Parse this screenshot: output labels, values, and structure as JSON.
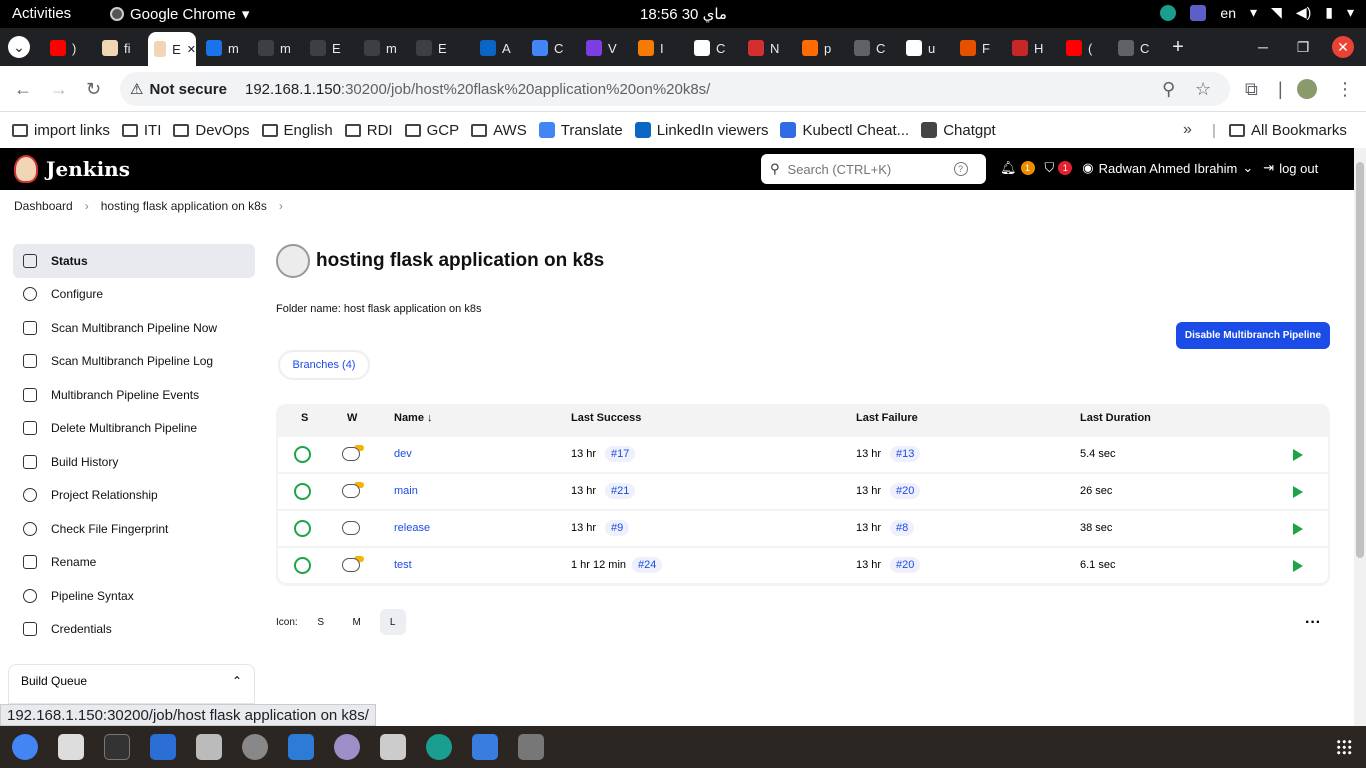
{
  "system": {
    "activities": "Activities",
    "app_name": "Google Chrome",
    "clock": "ماي 30  18:56",
    "lang": "en"
  },
  "tabs": [
    {
      "label": ")",
      "color": "#ff0000"
    },
    {
      "label": "fi",
      "color": "#f0d6b5"
    },
    {
      "label": "E",
      "color": "#f0d6b5",
      "active": true
    },
    {
      "label": "m",
      "color": "#1a73e8"
    },
    {
      "label": "m",
      "color": "#3c4043"
    },
    {
      "label": "E",
      "color": "#3c4043"
    },
    {
      "label": "m",
      "color": "#3c4043"
    },
    {
      "label": "E",
      "color": "#3c4043"
    },
    {
      "label": "A",
      "color": "#0a66c2"
    },
    {
      "label": "C",
      "color": "#4285f4"
    },
    {
      "label": "V",
      "color": "#7b3fe4"
    },
    {
      "label": "I",
      "color": "#f57c00"
    },
    {
      "label": "C",
      "color": "#ffffff"
    },
    {
      "label": "N",
      "color": "#d32f2f"
    },
    {
      "label": "p",
      "color": "#ff6d00"
    },
    {
      "label": "C",
      "color": "#5f6368"
    },
    {
      "label": "u",
      "color": "#ffffff"
    },
    {
      "label": "F",
      "color": "#e65100"
    },
    {
      "label": "H",
      "color": "#c62828"
    },
    {
      "label": "(",
      "color": "#ff0000"
    },
    {
      "label": "C",
      "color": "#5f6368"
    }
  ],
  "address": {
    "security": "Not secure",
    "host": "192.168.1.150",
    "path": ":30200/job/host%20flask%20application%20on%20k8s/"
  },
  "bookmarks": [
    {
      "label": "import links",
      "icon": "folder-icon"
    },
    {
      "label": "ITI",
      "icon": "folder-icon"
    },
    {
      "label": "DevOps",
      "icon": "folder-icon"
    },
    {
      "label": "English",
      "icon": "folder-icon"
    },
    {
      "label": "RDI",
      "icon": "folder-icon"
    },
    {
      "label": "GCP",
      "icon": "folder-icon"
    },
    {
      "label": "AWS",
      "icon": "folder-icon"
    },
    {
      "label": "Translate",
      "icon": "translate-icon"
    },
    {
      "label": "LinkedIn viewers",
      "icon": "linkedin-icon"
    },
    {
      "label": "Kubectl Cheat...",
      "icon": "kubernetes-icon"
    },
    {
      "label": "Chatgpt",
      "icon": "chatgpt-icon"
    }
  ],
  "all_bookmarks": "All Bookmarks",
  "jenkins": {
    "brand": "Jenkins",
    "search_placeholder": "Search (CTRL+K)",
    "notif_count": "1",
    "security_count": "1",
    "user": "Radwan Ahmed Ibrahim",
    "logout": "log out"
  },
  "breadcrumbs": [
    "Dashboard",
    "hosting flask application on k8s"
  ],
  "side": [
    {
      "label": "Status",
      "icon": "status-icon",
      "active": true
    },
    {
      "label": "Configure",
      "icon": "gear-icon"
    },
    {
      "label": "Scan Multibranch Pipeline Now",
      "icon": "play-icon"
    },
    {
      "label": "Scan Multibranch Pipeline Log",
      "icon": "terminal-icon"
    },
    {
      "label": "Multibranch Pipeline Events",
      "icon": "terminal-icon"
    },
    {
      "label": "Delete Multibranch Pipeline",
      "icon": "trash-icon"
    },
    {
      "label": "Build History",
      "icon": "history-icon"
    },
    {
      "label": "Project Relationship",
      "icon": "relationship-icon"
    },
    {
      "label": "Check File Fingerprint",
      "icon": "fingerprint-icon"
    },
    {
      "label": "Rename",
      "icon": "pencil-icon"
    },
    {
      "label": "Pipeline Syntax",
      "icon": "help-icon"
    },
    {
      "label": "Credentials",
      "icon": "credentials-icon"
    }
  ],
  "queue": {
    "label": "Build Queue"
  },
  "main": {
    "title": "hosting flask application on k8s",
    "folder_name": "Folder name: host flask application on k8s",
    "disable_btn": "Disable Multibranch Pipeline",
    "branches_tab": "Branches (4)",
    "columns": {
      "s": "S",
      "w": "W",
      "name": "Name  ↓",
      "success": "Last Success",
      "failure": "Last Failure",
      "duration": "Last Duration"
    },
    "rows": [
      {
        "name": "dev",
        "weather": "sunny-cloud",
        "success": "13 hr",
        "success_build": "#17",
        "failure": "13 hr",
        "failure_build": "#13",
        "duration": "5.4 sec"
      },
      {
        "name": "main",
        "weather": "sunny-cloud",
        "success": "13 hr",
        "success_build": "#21",
        "failure": "13 hr",
        "failure_build": "#20",
        "duration": "26 sec"
      },
      {
        "name": "release",
        "weather": "rain",
        "success": "13 hr",
        "success_build": "#9",
        "failure": "13 hr",
        "failure_build": "#8",
        "duration": "38 sec"
      },
      {
        "name": "test",
        "weather": "sunny-cloud",
        "success": "1 hr 12 min",
        "success_build": "#24",
        "failure": "13 hr",
        "failure_build": "#20",
        "duration": "6.1 sec"
      }
    ],
    "icon_label": "Icon:",
    "sizes": [
      "S",
      "M",
      "L"
    ]
  },
  "status_url": "192.168.1.150:30200/job/host flask application on k8s/"
}
